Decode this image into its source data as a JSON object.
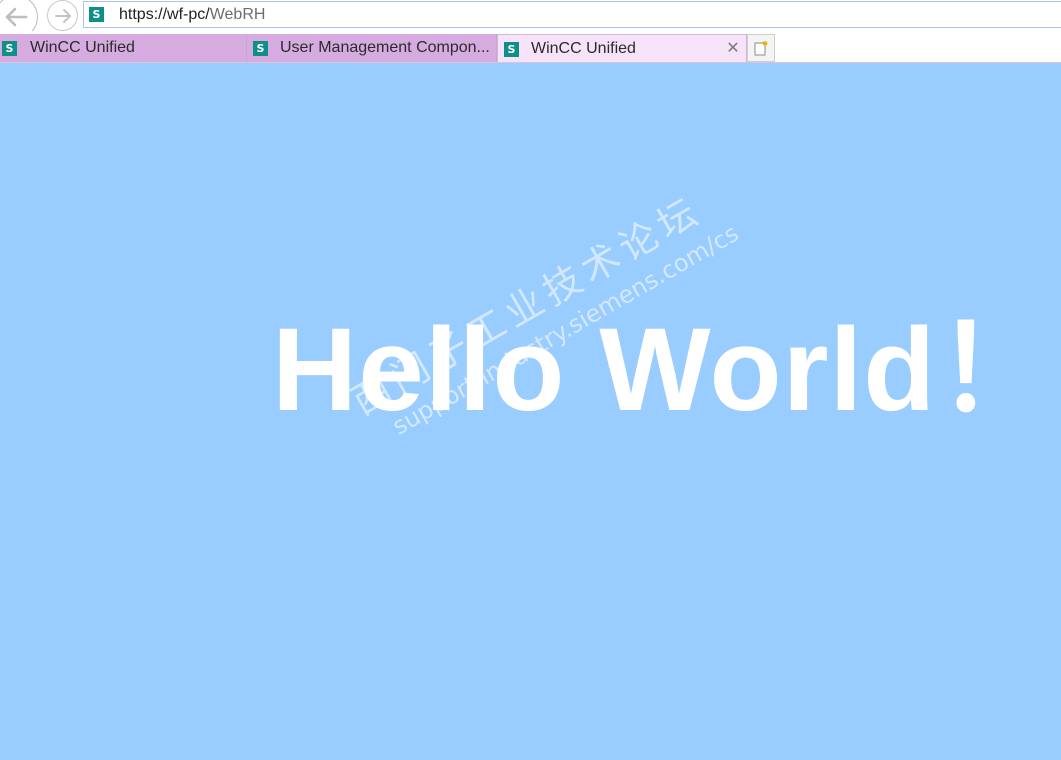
{
  "browser": {
    "url_base": "https://wf-pc/",
    "url_path": "WebRH",
    "favicon_letter": "S",
    "tabs": [
      {
        "label": "WinCC Unified",
        "favicon": "S"
      },
      {
        "label": "User Management Compon...",
        "favicon": "S"
      },
      {
        "label": "WinCC Unified",
        "favicon": "S",
        "close": "✕"
      }
    ]
  },
  "page": {
    "heading": "Hello World！",
    "watermark_line1": "西门子工业技术论坛",
    "watermark_line2": "support.industry.siemens.com/cs"
  },
  "colors": {
    "page_background": "#99ccff",
    "heading_color": "#ffffff",
    "tab_inactive": "#d6ace0",
    "tab_active": "#f6e2f9",
    "favicon": "#0e8f8a"
  }
}
